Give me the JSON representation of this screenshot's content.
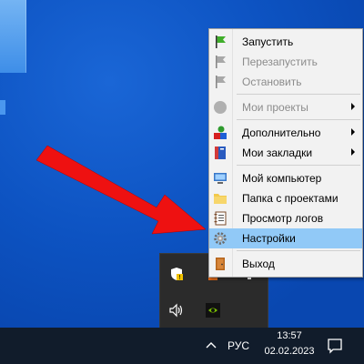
{
  "context_menu": {
    "items": [
      {
        "label": "Запустить",
        "icon": "green-flag-icon",
        "disabled": false,
        "submenu": false
      },
      {
        "label": "Перезапустить",
        "icon": "gray-flag-icon",
        "disabled": true,
        "submenu": false
      },
      {
        "label": "Остановить",
        "icon": "gray-flag-icon",
        "disabled": true,
        "submenu": false
      },
      {
        "label": "Мои проекты",
        "icon": "gray-circle-icon",
        "disabled": true,
        "submenu": true
      },
      {
        "label": "Дополнительно",
        "icon": "shapes-icon",
        "disabled": false,
        "submenu": true
      },
      {
        "label": "Мои закладки",
        "icon": "bookmarks-icon",
        "disabled": false,
        "submenu": true
      },
      {
        "label": "Мой компьютер",
        "icon": "computer-icon",
        "disabled": false,
        "submenu": false
      },
      {
        "label": "Папка с проектами",
        "icon": "folder-icon",
        "disabled": false,
        "submenu": false
      },
      {
        "label": "Просмотр логов",
        "icon": "log-notebook-icon",
        "disabled": false,
        "submenu": false
      },
      {
        "label": "Настройки",
        "icon": "gear-icon",
        "disabled": false,
        "submenu": false,
        "highlighted": true
      },
      {
        "label": "Выход",
        "icon": "exit-door-icon",
        "disabled": false,
        "submenu": false
      }
    ]
  },
  "tray_flyout": {
    "icons": [
      "security-shield-icon",
      "server-app-icon",
      "network-icon",
      "volume-icon",
      "nvidia-icon"
    ]
  },
  "taskbar": {
    "language": "РУС",
    "time": "13:57",
    "date": "02.02.2023"
  },
  "colors": {
    "desktop": "#0d53c2",
    "menu_highlight": "#91c9f7",
    "arrow": "#ee1111",
    "taskbar": "#111c2b"
  }
}
